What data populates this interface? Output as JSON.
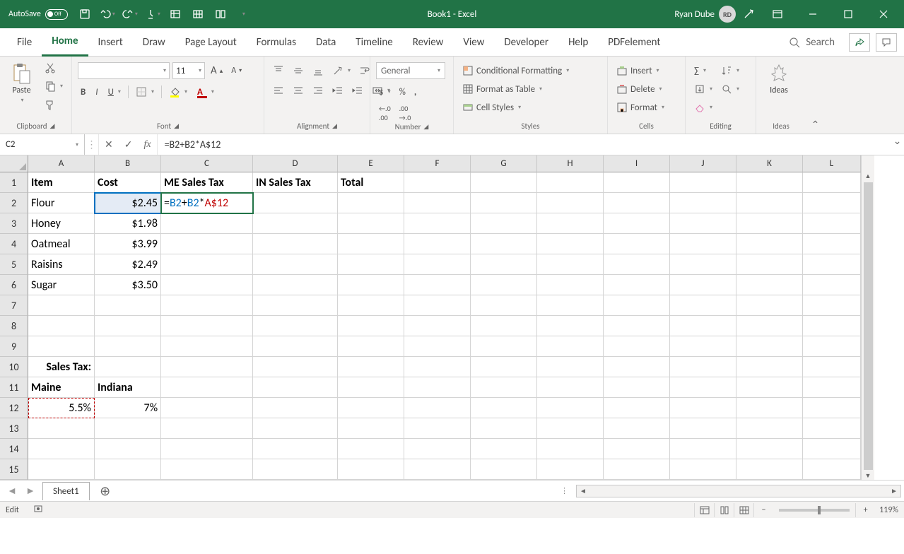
{
  "titlebar": {
    "autosave_label": "AutoSave",
    "autosave_state": "Off",
    "doc_title": "Book1  -  Excel",
    "user_name": "Ryan Dube",
    "user_initials": "RD"
  },
  "tabs": {
    "file": "File",
    "home": "Home",
    "insert": "Insert",
    "draw": "Draw",
    "page_layout": "Page Layout",
    "formulas": "Formulas",
    "data": "Data",
    "timeline": "Timeline",
    "review": "Review",
    "view": "View",
    "developer": "Developer",
    "help": "Help",
    "pdfelement": "PDFelement",
    "search": "Search"
  },
  "ribbon": {
    "clipboard": {
      "paste": "Paste",
      "label": "Clipboard"
    },
    "font": {
      "size": "11",
      "label": "Font"
    },
    "alignment": {
      "label": "Alignment"
    },
    "number": {
      "format": "General",
      "label": "Number"
    },
    "styles": {
      "cond_format": "Conditional Formatting",
      "format_table": "Format as Table",
      "cell_styles": "Cell Styles",
      "label": "Styles"
    },
    "cells": {
      "insert": "Insert",
      "delete": "Delete",
      "format": "Format",
      "label": "Cells"
    },
    "editing": {
      "label": "Editing"
    },
    "ideas": {
      "btn": "Ideas",
      "label": "Ideas"
    }
  },
  "fbar": {
    "namebox": "C2",
    "formula": "=B2+B2*A$12"
  },
  "columns": [
    "A",
    "B",
    "C",
    "D",
    "E",
    "F",
    "G",
    "H",
    "I",
    "J",
    "K",
    "L"
  ],
  "rows": [
    "1",
    "2",
    "3",
    "4",
    "5",
    "6",
    "7",
    "8",
    "9",
    "10",
    "11",
    "12",
    "13",
    "14",
    "15"
  ],
  "sheet": {
    "headers": {
      "item": "Item",
      "cost": "Cost",
      "me": "ME Sales Tax",
      "in": "IN Sales Tax",
      "total": "Total"
    },
    "items": [
      {
        "name": "Flour",
        "cost": "$2.45"
      },
      {
        "name": "Honey",
        "cost": "$1.98"
      },
      {
        "name": "Oatmeal",
        "cost": "$3.99"
      },
      {
        "name": "Raisins",
        "cost": "$2.49"
      },
      {
        "name": "Sugar",
        "cost": "$3.50"
      }
    ],
    "edit_formula": {
      "eq": "=",
      "b2a": "B2",
      "plus": "+",
      "b2b": "B2",
      "star": "*",
      "a12": "A$12"
    },
    "tax_label": "Sales Tax:",
    "states": {
      "me": "Maine",
      "in": "Indiana"
    },
    "rates": {
      "me": "5.5%",
      "in": "7%"
    }
  },
  "sheettab": {
    "name": "Sheet1"
  },
  "status": {
    "mode": "Edit",
    "zoom": "119%"
  }
}
